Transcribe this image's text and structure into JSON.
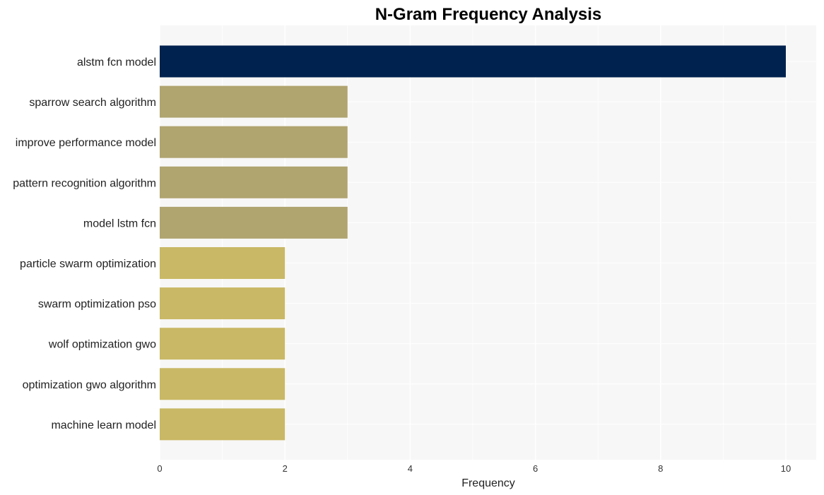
{
  "chart_data": {
    "type": "bar",
    "orientation": "horizontal",
    "title": "N-Gram Frequency Analysis",
    "xlabel": "Frequency",
    "ylabel": "",
    "xlim": [
      0,
      10.5
    ],
    "xticks": [
      0,
      2,
      4,
      6,
      8,
      10
    ],
    "grid": true,
    "legend": "none",
    "categories": [
      "alstm fcn model",
      "sparrow search algorithm",
      "improve performance model",
      "pattern recognition algorithm",
      "model lstm fcn",
      "particle swarm optimization",
      "swarm optimization pso",
      "wolf optimization gwo",
      "optimization gwo algorithm",
      "machine learn model"
    ],
    "values": [
      10,
      3,
      3,
      3,
      3,
      2,
      2,
      2,
      2,
      2
    ],
    "colors": {
      "10": "#00224e",
      "3": "#b0a46f",
      "2": "#c9b865"
    },
    "plot_background": "#f7f7f7"
  }
}
